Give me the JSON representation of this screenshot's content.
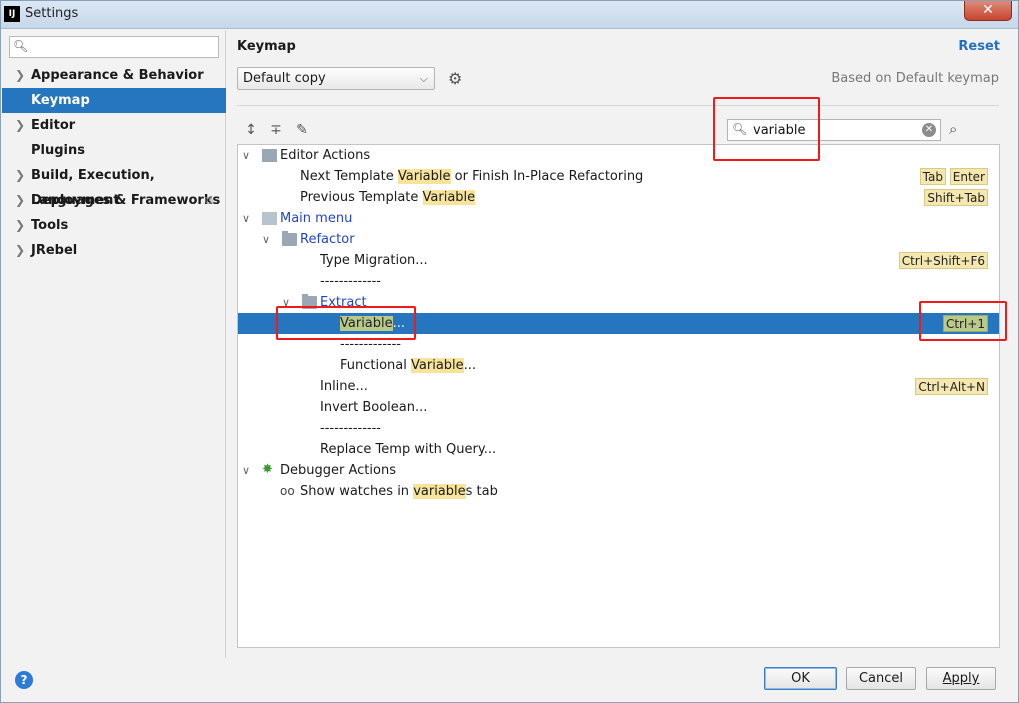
{
  "window": {
    "title": "Settings",
    "app_icon": "IJ",
    "close_glyph": "✕"
  },
  "sidebar": {
    "search_placeholder": "",
    "items": [
      {
        "label": "Appearance & Behavior",
        "expandable": true
      },
      {
        "label": "Keymap",
        "expandable": false,
        "selected": true
      },
      {
        "label": "Editor",
        "expandable": true
      },
      {
        "label": "Plugins",
        "expandable": false
      },
      {
        "label": "Build, Execution, Deployment",
        "expandable": true
      },
      {
        "label": "Languages & Frameworks",
        "expandable": true
      },
      {
        "label": "Tools",
        "expandable": true
      },
      {
        "label": "JRebel",
        "expandable": true
      }
    ]
  },
  "header": {
    "title": "Keymap",
    "reset_label": "Reset"
  },
  "keymap": {
    "selected": "Default copy",
    "based_on": "Based on Default keymap"
  },
  "filter": {
    "value": "variable"
  },
  "tree": {
    "editor_actions": "Editor Actions",
    "next_template_pre": "Next Template ",
    "next_template_hl": "Variable",
    "next_template_post": " or Finish In-Place Refactoring",
    "next_template_sc1": "Tab",
    "next_template_sc2": "Enter",
    "prev_template_pre": "Previous Template ",
    "prev_template_hl": "Variable",
    "prev_template_sc": "Shift+Tab",
    "main_menu": "Main menu",
    "refactor": "Refactor",
    "type_migration": "Type Migration...",
    "type_migration_sc": "Ctrl+Shift+F6",
    "sep": "-------------",
    "extract": "Extract",
    "variable_hl": "Variable",
    "variable_post": "...",
    "variable_sc": "Ctrl+1",
    "functional_pre": "Functional ",
    "functional_hl": "Variable",
    "functional_post": "...",
    "inline": "Inline...",
    "inline_sc": "Ctrl+Alt+N",
    "invert_boolean": "Invert Boolean...",
    "replace_temp": "Replace Temp with Query...",
    "debugger_actions": "Debugger Actions",
    "show_watches_pre": "Show watches in ",
    "show_watches_hl": "variable",
    "show_watches_post": "s tab"
  },
  "footer": {
    "ok": "OK",
    "cancel": "Cancel",
    "apply": "Apply",
    "help": "?"
  },
  "colors": {
    "selection": "#2675bf",
    "highlight": "#f7e49a",
    "annotation_red": "#ee1b1b",
    "link": "#2470c2"
  }
}
